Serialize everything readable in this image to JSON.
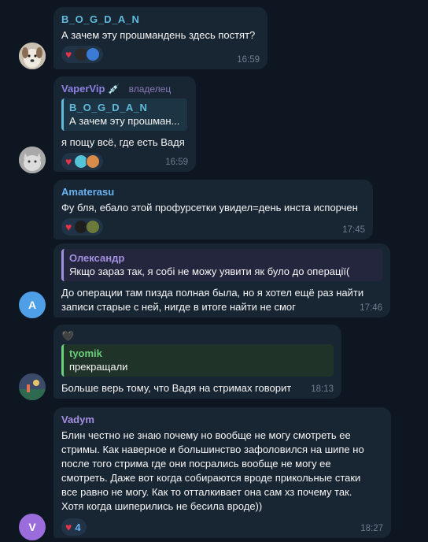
{
  "messages": [
    {
      "author": "B_O_G_D_A_N",
      "author_color": "#5fbadb",
      "text": "А зачем эту прошмандень здесь постят?",
      "time": "16:59"
    },
    {
      "author": "VaperVip",
      "author_color": "#8b80e0",
      "author_emoji": "💉",
      "badge": "владелец",
      "reply_author": "B_O_G_D_A_N",
      "reply_color": "#5fbadb",
      "reply_text": "А зачем эту прошман...",
      "text": "я пощу всё, где есть Вадя",
      "time": "16:59"
    },
    {
      "author": "Amaterasu",
      "author_color": "#6ab2f2",
      "text": "Фу бля, ебало этой профурсетки увидел=день инста испорчен",
      "time": "17:45"
    },
    {
      "avatar_letter": "A",
      "reply_author": "Олександр",
      "reply_color": "#a48fe0",
      "reply_text": "Якщо зараз так, я собі не можу уявити як було до операції(",
      "text_lines": [
        "До операции там пизда полная была, но я хотел ещё раз найти",
        "записи старые с ней, нигде в итоге найти не смог"
      ],
      "time": "17:46"
    },
    {
      "top_emoji": "🖤",
      "reply_author": "tyomik",
      "reply_color": "#6ccf7b",
      "reply_text": "прекращали",
      "text": "Больше верь тому, что Вадя на стримах говорит",
      "time": "18:13"
    },
    {
      "author": "Vadym",
      "author_color": "#a48fe0",
      "avatar_letter": "V",
      "text_lines": [
        "Блин честно не знаю почему но вообще не могу смотреть ее",
        "стримы. Как наверное и большинство зафоловился на шипе но",
        "после того стрима где они посрались вообще не могу ее",
        "смотреть. Даже вот когда собираются вроде прикольные стаки",
        "все равно не могу. Как то отталкивает она сам хз почему так.",
        "Хотя когда шиперились не бесила вроде))"
      ],
      "reaction_count": "4",
      "time": "18:27"
    }
  ],
  "colors": {
    "background": "#0e1621",
    "bubble": "#182533",
    "heart": "#e8334a",
    "time": "#6d7f8f"
  }
}
